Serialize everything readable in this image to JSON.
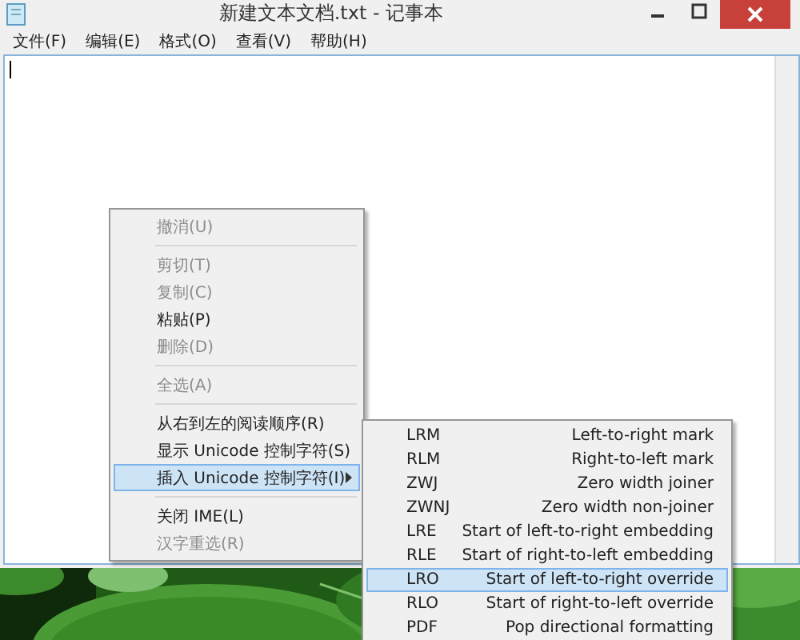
{
  "window": {
    "title": "新建文本文档.txt - 记事本"
  },
  "menu_bar": [
    {
      "label": "文件(F)"
    },
    {
      "label": "编辑(E)"
    },
    {
      "label": "格式(O)"
    },
    {
      "label": "查看(V)"
    },
    {
      "label": "帮助(H)"
    }
  ],
  "context_menu": [
    {
      "kind": "item",
      "label": "撤消(U)",
      "disabled": true,
      "selected": false,
      "submenu": false
    },
    {
      "kind": "separator"
    },
    {
      "kind": "item",
      "label": "剪切(T)",
      "disabled": true,
      "selected": false,
      "submenu": false
    },
    {
      "kind": "item",
      "label": "复制(C)",
      "disabled": true,
      "selected": false,
      "submenu": false
    },
    {
      "kind": "item",
      "label": "粘贴(P)",
      "disabled": false,
      "selected": false,
      "submenu": false
    },
    {
      "kind": "item",
      "label": "删除(D)",
      "disabled": true,
      "selected": false,
      "submenu": false
    },
    {
      "kind": "separator"
    },
    {
      "kind": "item",
      "label": "全选(A)",
      "disabled": true,
      "selected": false,
      "submenu": false
    },
    {
      "kind": "separator"
    },
    {
      "kind": "item",
      "label": "从右到左的阅读顺序(R)",
      "disabled": false,
      "selected": false,
      "submenu": false
    },
    {
      "kind": "item",
      "label": "显示 Unicode 控制字符(S)",
      "disabled": false,
      "selected": false,
      "submenu": false
    },
    {
      "kind": "item",
      "label": "插入 Unicode 控制字符(I)",
      "disabled": false,
      "selected": true,
      "submenu": true
    },
    {
      "kind": "separator"
    },
    {
      "kind": "item",
      "label": "关闭 IME(L)",
      "disabled": false,
      "selected": false,
      "submenu": false
    },
    {
      "kind": "item",
      "label": "汉字重选(R)",
      "disabled": true,
      "selected": false,
      "submenu": false
    }
  ],
  "submenu": [
    {
      "code": "LRM",
      "description": "Left-to-right mark",
      "selected": false
    },
    {
      "code": "RLM",
      "description": "Right-to-left mark",
      "selected": false
    },
    {
      "code": "ZWJ",
      "description": "Zero width joiner",
      "selected": false
    },
    {
      "code": "ZWNJ",
      "description": "Zero width non-joiner",
      "selected": false
    },
    {
      "code": "LRE",
      "description": "Start of left-to-right embedding",
      "selected": false
    },
    {
      "code": "RLE",
      "description": "Start of right-to-left embedding",
      "selected": false
    },
    {
      "code": "LRO",
      "description": "Start of left-to-right override",
      "selected": true
    },
    {
      "code": "RLO",
      "description": "Start of right-to-left override",
      "selected": false
    },
    {
      "code": "PDF",
      "description": "Pop directional formatting",
      "selected": false
    }
  ]
}
